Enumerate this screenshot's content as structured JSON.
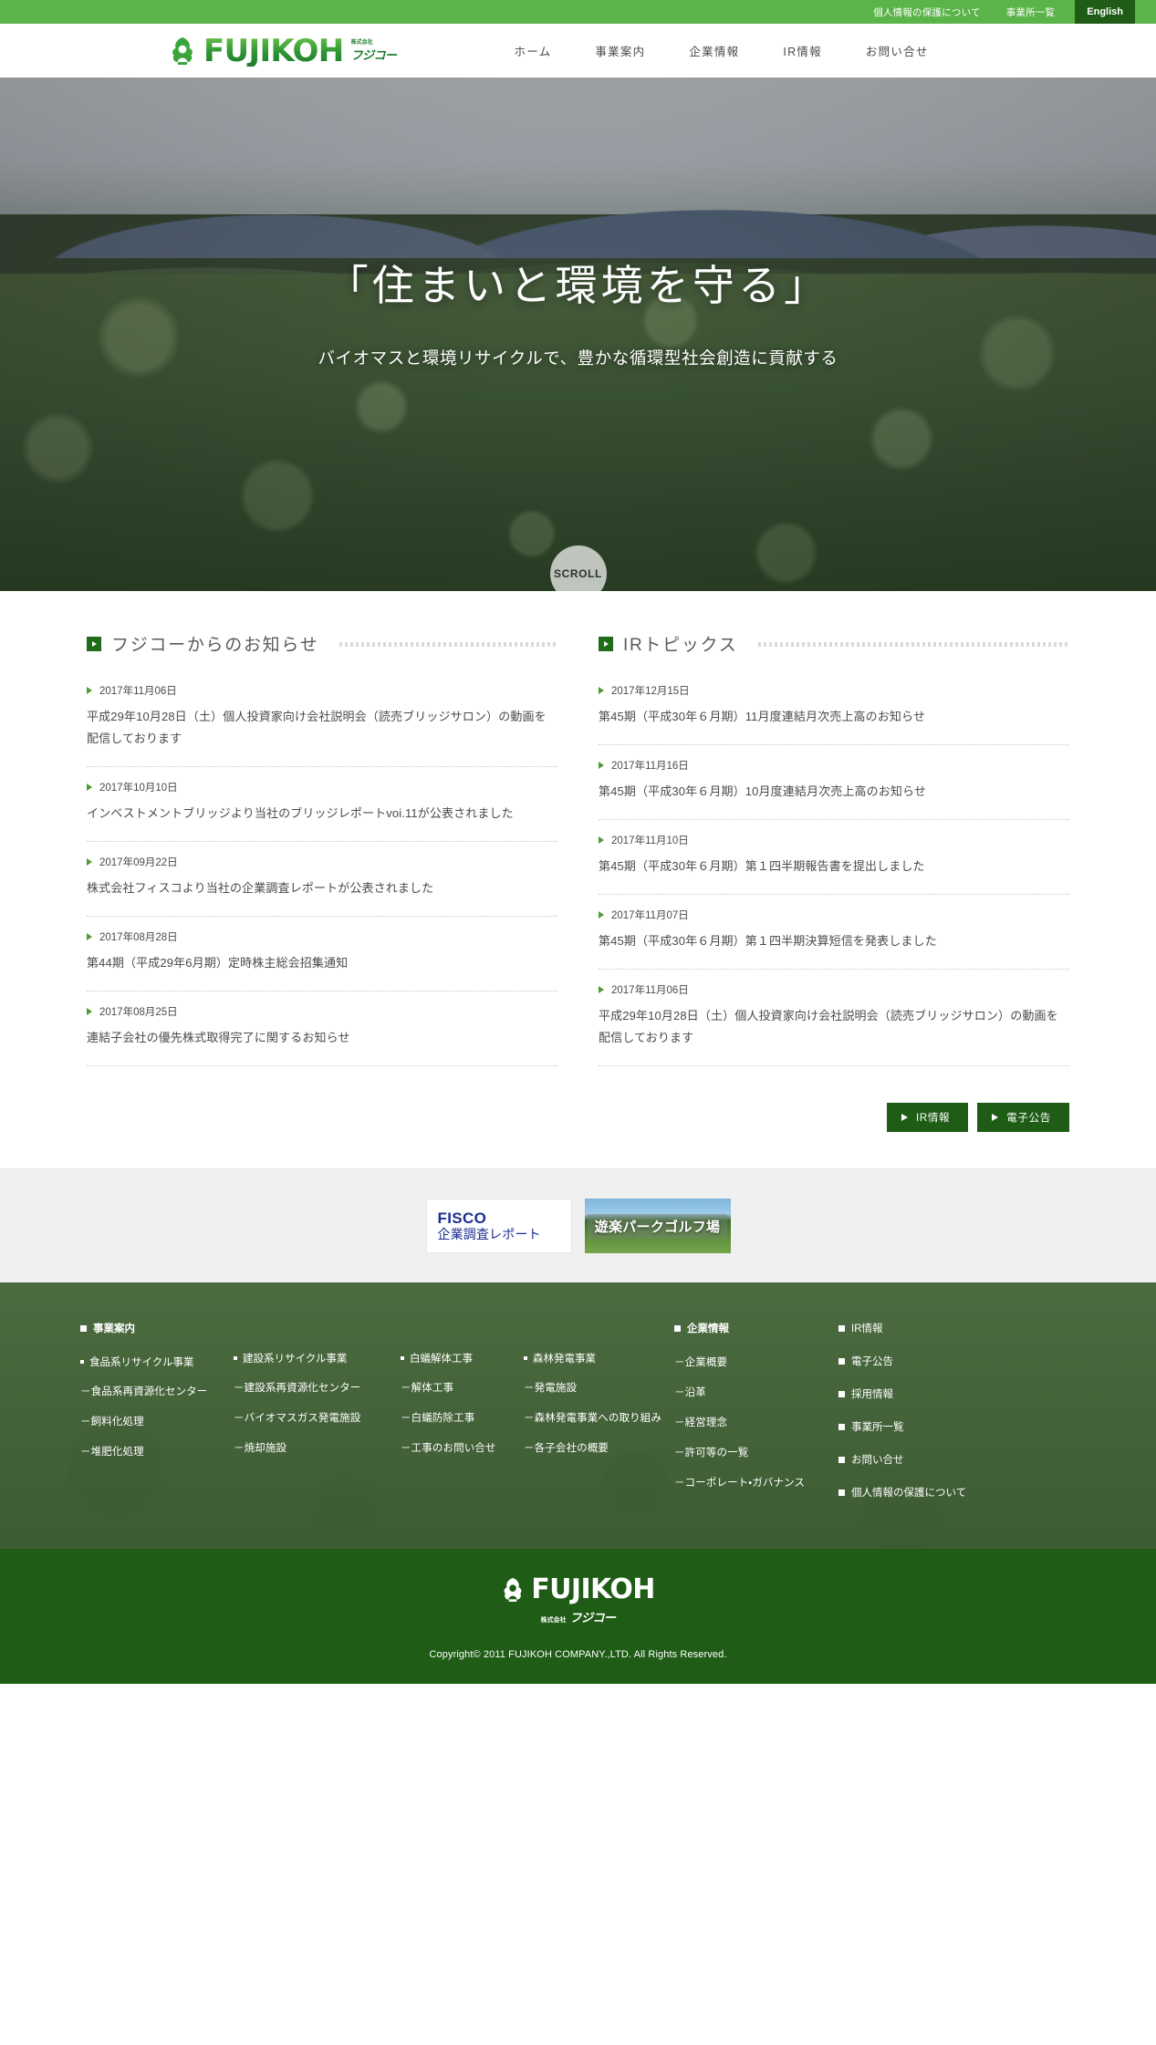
{
  "topbar": {
    "links": [
      {
        "label": "個人情報の保護について",
        "name": "privacy-policy"
      },
      {
        "label": "事業所一覧",
        "name": "offices-list"
      }
    ],
    "button": {
      "label": "English",
      "name": "english"
    }
  },
  "header": {
    "logo": {
      "word": "FUJIKOH",
      "kk": "株式会社",
      "jp": "フジコー",
      "icon": "tree-logo-icon"
    },
    "nav": [
      {
        "label": "ホーム",
        "name": "home"
      },
      {
        "label": "事業案内",
        "name": "business"
      },
      {
        "label": "企業情報",
        "name": "company"
      },
      {
        "label": "IR情報",
        "name": "ir"
      },
      {
        "label": "お問い合せ",
        "name": "contact"
      }
    ]
  },
  "hero": {
    "title": "「住まいと環境を守る」",
    "subtitle": "バイオマスと環境リサイクルで、豊かな循環型社会創造に貢献する",
    "scroll_label": "SCROLL"
  },
  "news": {
    "left": {
      "title": "フジコーからのお知らせ",
      "items": [
        {
          "date": "2017年11月06日",
          "text": "平成29年10月28日（土）個人投資家向け会社説明会（読売ブリッジサロン）の動画を配信しております"
        },
        {
          "date": "2017年10月10日",
          "text": "インベストメントブリッジより当社のブリッジレポートvoi.11が公表されました"
        },
        {
          "date": "2017年09月22日",
          "text": "株式会社フィスコより当社の企業調査レポートが公表されました"
        },
        {
          "date": "2017年08月28日",
          "text": "第44期（平成29年6月期）定時株主総会招集通知"
        },
        {
          "date": "2017年08月25日",
          "text": "連結子会社の優先株式取得完了に関するお知らせ"
        }
      ]
    },
    "right": {
      "title": "IRトピックス",
      "items": [
        {
          "date": "2017年12月15日",
          "text": "第45期（平成30年６月期）11月度連結月次売上高のお知らせ"
        },
        {
          "date": "2017年11月16日",
          "text": "第45期（平成30年６月期）10月度連結月次売上高のお知らせ"
        },
        {
          "date": "2017年11月10日",
          "text": "第45期（平成30年６月期）第１四半期報告書を提出しました"
        },
        {
          "date": "2017年11月07日",
          "text": "第45期（平成30年６月期）第１四半期決算短信を発表しました"
        },
        {
          "date": "2017年11月06日",
          "text": "平成29年10月28日（土）個人投資家向け会社説明会（読売ブリッジサロン）の動画を配信しております"
        }
      ]
    }
  },
  "buttons": [
    {
      "label": "IR情報",
      "name": "ir-info-button"
    },
    {
      "label": "電子公告",
      "name": "electronic-notice-button"
    }
  ],
  "banners": {
    "fisco": {
      "line1": "FISCO",
      "line2": "企業調査レポート"
    },
    "golf": {
      "label": "遊楽パークゴルフ場"
    }
  },
  "footer": {
    "columns": [
      {
        "head": "事業案内",
        "groups": [
          {
            "title": "食品系リサイクル事業",
            "links": [
              "－食品系再資源化センター",
              "－飼料化処理",
              "－堆肥化処理"
            ]
          }
        ]
      },
      {
        "head": "",
        "groups": [
          {
            "title": "建設系リサイクル事業",
            "links": [
              "－建設系再資源化センター",
              "－バイオマスガス発電施設",
              "－焼却施設"
            ]
          }
        ]
      },
      {
        "head": "",
        "groups": [
          {
            "title": "白蟻解体工事",
            "links": [
              "－解体工事",
              "－白蟻防除工事",
              "－工事のお問い合せ"
            ]
          }
        ]
      },
      {
        "head": "",
        "groups": [
          {
            "title": "森林発電事業",
            "links": [
              "－発電施設",
              "－森林発電事業への取り組み",
              "－各子会社の概要"
            ]
          }
        ]
      }
    ],
    "company_col": {
      "head": "企業情報",
      "links": [
        "－企業概要",
        "－沿革",
        "－経営理念",
        "－許可等の一覧",
        "－コーポレート・ガバナンス"
      ]
    },
    "ir_col": {
      "links": [
        "IR情報",
        "電子公告",
        "採用情報",
        "事業所一覧",
        "お問い合せ",
        "個人情報の保護について"
      ]
    },
    "logo": {
      "word": "FUJIKOH",
      "kk": "株式会社",
      "jp": "フジコー"
    },
    "copyright": "Copyright© 2011 FUJIKOH COMPANY.,LTD. All Rights Reserved."
  }
}
